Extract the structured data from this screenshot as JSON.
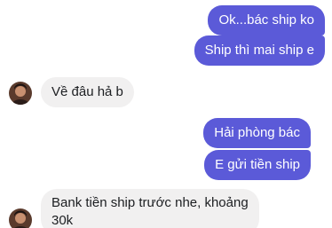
{
  "conversation": {
    "messages": [
      {
        "direction": "out",
        "text": "Ok...bác ship ko"
      },
      {
        "direction": "out",
        "text": "Ship thì mai ship e"
      },
      {
        "direction": "in",
        "text": "Về đâu hả b"
      },
      {
        "direction": "out",
        "text": "Hải phòng bác"
      },
      {
        "direction": "out",
        "text": "E gửi tiền ship"
      },
      {
        "direction": "in",
        "text_line1": "Bank tiền ship trước nhe, khoảng",
        "text_line2": "30k"
      }
    ]
  },
  "colors": {
    "outgoing_bubble": "#5b5ad8",
    "incoming_bubble": "#f1f0f0"
  },
  "icons": {
    "sender_avatar": "contact-avatar-icon"
  }
}
